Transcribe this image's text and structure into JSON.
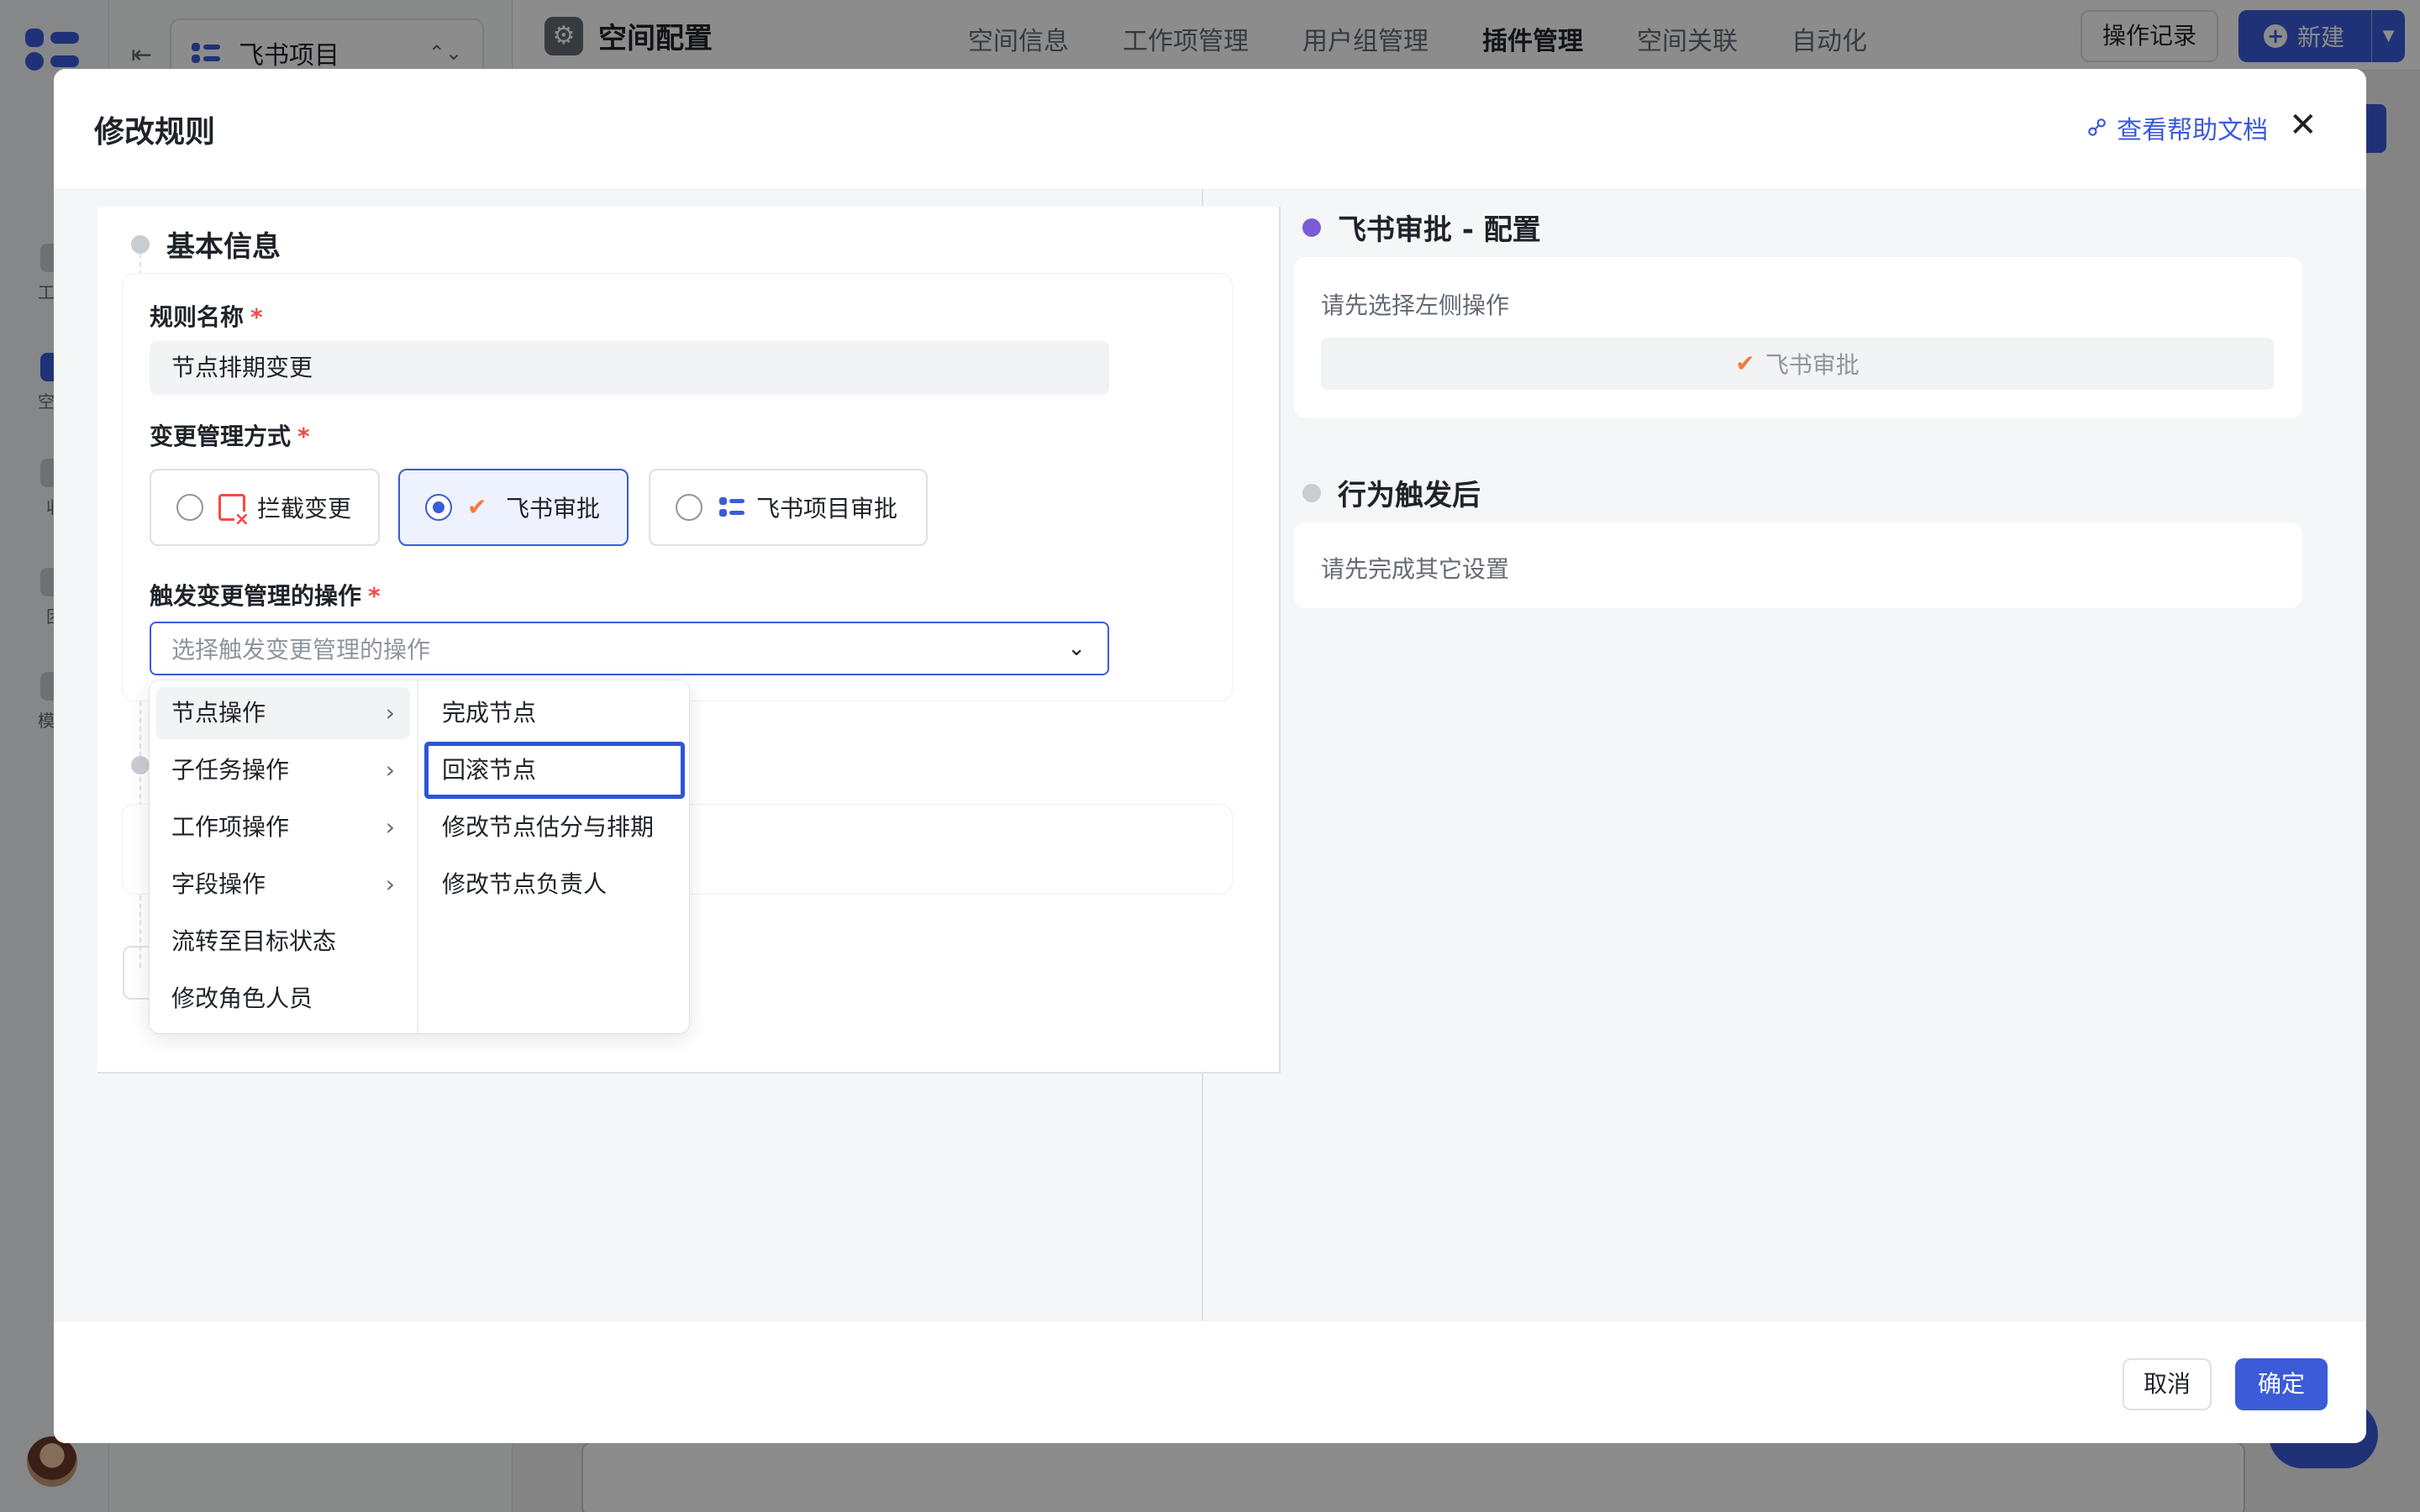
{
  "background": {
    "project_selector": {
      "name": "飞书项目"
    },
    "topbar": {
      "title": "空间配置",
      "nav": [
        "空间信息",
        "工作项管理",
        "用户组管理",
        "插件管理",
        "空间关联",
        "自动化"
      ],
      "active_nav": "插件管理",
      "log_button": "操作记录",
      "new_button": "新建"
    },
    "rail": [
      {
        "label": "工作"
      },
      {
        "label": "空间"
      },
      {
        "label": "收"
      },
      {
        "label": "团"
      },
      {
        "label": "模板"
      }
    ]
  },
  "modal": {
    "title": "修改规则",
    "help_link": "查看帮助文档",
    "footer": {
      "cancel": "取消",
      "confirm": "确定"
    }
  },
  "basic_info": {
    "section_title": "基本信息",
    "rule_name_label": "规则名称",
    "required_mark": "*",
    "rule_name_value": "节点排期变更",
    "mode_label": "变更管理方式",
    "modes": [
      {
        "label": "拦截变更",
        "selected": false
      },
      {
        "label": "飞书审批",
        "selected": true
      },
      {
        "label": "飞书项目审批",
        "selected": false
      }
    ],
    "trigger_label": "触发变更管理的操作",
    "trigger_placeholder": "选择触发变更管理的操作"
  },
  "cascade": {
    "level1": [
      {
        "label": "节点操作",
        "has_children": true,
        "active": true
      },
      {
        "label": "子任务操作",
        "has_children": true
      },
      {
        "label": "工作项操作",
        "has_children": true
      },
      {
        "label": "字段操作",
        "has_children": true
      },
      {
        "label": "流转至目标状态",
        "has_children": false
      },
      {
        "label": "修改角色人员",
        "has_children": false
      }
    ],
    "level2": [
      {
        "label": "完成节点"
      },
      {
        "label": "回滚节点",
        "highlighted": true
      },
      {
        "label": "修改节点估分与排期"
      },
      {
        "label": "修改节点负责人"
      }
    ]
  },
  "right_panel": {
    "config_title": "飞书审批 - 配置",
    "config_hint": "请先选择左侧操作",
    "approval_label": "飞书审批",
    "after_title": "行为触发后",
    "after_hint": "请先完成其它设置"
  },
  "colors": {
    "primary": "#3b5bd9",
    "required": "#f54a45",
    "feishu_orange": "#f57a3a",
    "config_dot": "#7b5bd6"
  }
}
